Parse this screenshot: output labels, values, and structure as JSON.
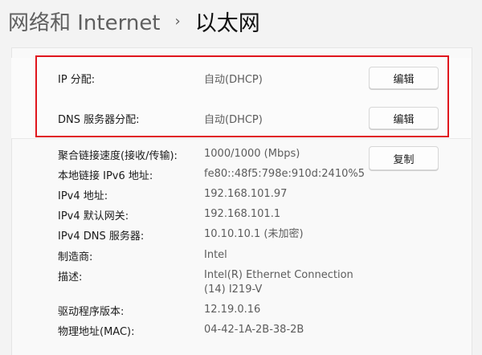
{
  "header": {
    "parent": "网络和 Internet",
    "current": "以太网"
  },
  "ip_settings": [
    {
      "label": "IP 分配:",
      "value": "自动(DHCP)",
      "button": "编辑"
    },
    {
      "label": "DNS 服务器分配:",
      "value": "自动(DHCP)",
      "button": "编辑"
    }
  ],
  "properties": {
    "copy_button": "复制",
    "items": [
      {
        "label": "聚合链接速度(接收/传输):",
        "value": "1000/1000 (Mbps)"
      },
      {
        "label": "本地链接 IPv6 地址:",
        "value": "fe80::48f5:798e:910d:2410%5"
      },
      {
        "label": "IPv4 地址:",
        "value": "192.168.101.97"
      },
      {
        "label": "IPv4 默认网关:",
        "value": "192.168.101.1"
      },
      {
        "label": "IPv4 DNS 服务器:",
        "value": "10.10.10.1 (未加密)"
      },
      {
        "label": "制造商:",
        "value": "Intel"
      },
      {
        "label": "描述:",
        "value": "Intel(R) Ethernet Connection",
        "value2": "(14) I219-V"
      },
      {
        "label": "驱动程序版本:",
        "value": "12.19.0.16"
      },
      {
        "label": "物理地址(MAC):",
        "value": "04-42-1A-2B-38-2B"
      }
    ]
  }
}
